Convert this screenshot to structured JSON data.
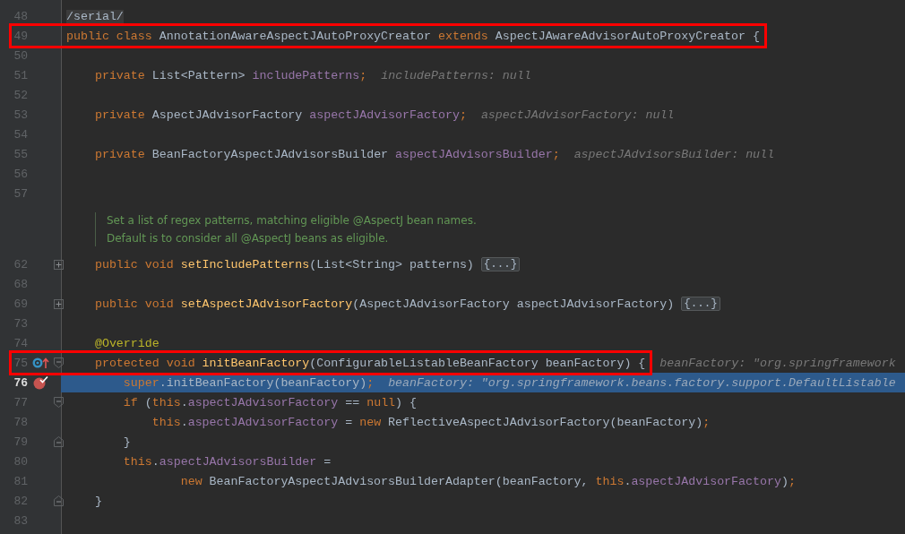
{
  "editor": {
    "rows": [
      {
        "kind": "code",
        "number": "48",
        "tokens": [
          {
            "text": "/serial/",
            "kind": "folded"
          }
        ]
      },
      {
        "kind": "code",
        "number": "49",
        "boxed": true,
        "tokens": [
          {
            "text": "public class ",
            "kind": "kw"
          },
          {
            "text": "AnnotationAwareAspectJAutoProxyCreator ",
            "kind": "plain"
          },
          {
            "text": "extends ",
            "kind": "kw"
          },
          {
            "text": "AspectJAwareAdvisorAutoProxyCreator {",
            "kind": "plain"
          }
        ]
      },
      {
        "kind": "code",
        "number": "50",
        "tokens": []
      },
      {
        "kind": "code",
        "number": "51",
        "tokens": [
          {
            "text": "    private ",
            "kind": "kw"
          },
          {
            "text": "List<Pattern> ",
            "kind": "plain"
          },
          {
            "text": "includePatterns",
            "kind": "field"
          },
          {
            "text": ";",
            "kind": "kw"
          }
        ],
        "hint": "includePatterns: null"
      },
      {
        "kind": "code",
        "number": "52",
        "tokens": []
      },
      {
        "kind": "code",
        "number": "53",
        "tokens": [
          {
            "text": "    private ",
            "kind": "kw"
          },
          {
            "text": "AspectJAdvisorFactory ",
            "kind": "plain"
          },
          {
            "text": "aspectJAdvisorFactory",
            "kind": "field"
          },
          {
            "text": ";",
            "kind": "kw"
          }
        ],
        "hint": "aspectJAdvisorFactory: null"
      },
      {
        "kind": "code",
        "number": "54",
        "tokens": []
      },
      {
        "kind": "code",
        "number": "55",
        "tokens": [
          {
            "text": "    private ",
            "kind": "kw"
          },
          {
            "text": "BeanFactoryAspectJAdvisorsBuilder ",
            "kind": "plain"
          },
          {
            "text": "aspectJAdvisorsBuilder",
            "kind": "field"
          },
          {
            "text": ";",
            "kind": "kw"
          }
        ],
        "hint": "aspectJAdvisorsBuilder: null"
      },
      {
        "kind": "code",
        "number": "56",
        "tokens": []
      },
      {
        "kind": "code",
        "number": "57",
        "tokens": []
      },
      {
        "kind": "doc",
        "lines": [
          "Set a list of regex patterns, matching eligible @AspectJ bean names.",
          "Default is to consider all @AspectJ beans as eligible."
        ]
      },
      {
        "kind": "code",
        "number": "62",
        "fold": {
          "kind": "expand"
        },
        "tokens": [
          {
            "text": "    public void ",
            "kind": "kw"
          },
          {
            "text": "setIncludePatterns",
            "kind": "method"
          },
          {
            "text": "(List<String> patterns) ",
            "kind": "plain"
          }
        ],
        "placeholder": "{...}"
      },
      {
        "kind": "code",
        "number": "68",
        "tokens": []
      },
      {
        "kind": "code",
        "number": "69",
        "fold": {
          "kind": "expand"
        },
        "tokens": [
          {
            "text": "    public void ",
            "kind": "kw"
          },
          {
            "text": "setAspectJAdvisorFactory",
            "kind": "method"
          },
          {
            "text": "(AspectJAdvisorFactory aspectJAdvisorFactory) ",
            "kind": "plain"
          }
        ],
        "placeholder": "{...}"
      },
      {
        "kind": "code",
        "number": "73",
        "tokens": []
      },
      {
        "kind": "code",
        "number": "74",
        "tokens": [
          {
            "text": "    @Override",
            "kind": "annot"
          }
        ]
      },
      {
        "kind": "code",
        "number": "75",
        "boxed": true,
        "marker": {
          "kind": "override"
        },
        "fold": {
          "kind": "start"
        },
        "tokens": [
          {
            "text": "    protected void ",
            "kind": "kw"
          },
          {
            "text": "initBeanFactory",
            "kind": "method"
          },
          {
            "text": "(ConfigurableListableBeanFactory beanFactory) {",
            "kind": "plain"
          }
        ],
        "hint": "beanFactory: \"org.springframework"
      },
      {
        "kind": "code",
        "number": "76",
        "current": true,
        "marker": {
          "kind": "breakpoint"
        },
        "tokens": [
          {
            "text": "        super",
            "kind": "kw"
          },
          {
            "text": ".initBeanFactory(beanFactory)",
            "kind": "plain"
          },
          {
            "text": ";",
            "kind": "kw"
          }
        ],
        "hint": "beanFactory: \"org.springframework.beans.factory.support.DefaultListable"
      },
      {
        "kind": "code",
        "number": "77",
        "fold": {
          "kind": "start"
        },
        "tokens": [
          {
            "text": "        if ",
            "kind": "kw"
          },
          {
            "text": "(",
            "kind": "plain"
          },
          {
            "text": "this",
            "kind": "kw"
          },
          {
            "text": ".",
            "kind": "plain"
          },
          {
            "text": "aspectJAdvisorFactory",
            "kind": "field"
          },
          {
            "text": " == ",
            "kind": "plain"
          },
          {
            "text": "null",
            "kind": "kw"
          },
          {
            "text": ") {",
            "kind": "plain"
          }
        ]
      },
      {
        "kind": "code",
        "number": "78",
        "tokens": [
          {
            "text": "            this",
            "kind": "kw"
          },
          {
            "text": ".",
            "kind": "plain"
          },
          {
            "text": "aspectJAdvisorFactory",
            "kind": "field"
          },
          {
            "text": " = ",
            "kind": "plain"
          },
          {
            "text": "new ",
            "kind": "kw"
          },
          {
            "text": "ReflectiveAspectJAdvisorFactory(beanFactory)",
            "kind": "plain"
          },
          {
            "text": ";",
            "kind": "kw"
          }
        ]
      },
      {
        "kind": "code",
        "number": "79",
        "fold": {
          "kind": "end"
        },
        "tokens": [
          {
            "text": "        }",
            "kind": "plain"
          }
        ]
      },
      {
        "kind": "code",
        "number": "80",
        "tokens": [
          {
            "text": "        this",
            "kind": "kw"
          },
          {
            "text": ".",
            "kind": "plain"
          },
          {
            "text": "aspectJAdvisorsBuilder",
            "kind": "field"
          },
          {
            "text": " =",
            "kind": "plain"
          }
        ]
      },
      {
        "kind": "code",
        "number": "81",
        "tokens": [
          {
            "text": "                new ",
            "kind": "kw"
          },
          {
            "text": "BeanFactoryAspectJAdvisorsBuilderAdapter(beanFactory, ",
            "kind": "plain"
          },
          {
            "text": "this",
            "kind": "kw"
          },
          {
            "text": ".",
            "kind": "plain"
          },
          {
            "text": "aspectJAdvisorFactory",
            "kind": "field"
          },
          {
            "text": ")",
            "kind": "plain"
          },
          {
            "text": ";",
            "kind": "kw"
          }
        ]
      },
      {
        "kind": "code",
        "number": "82",
        "fold": {
          "kind": "end"
        },
        "tokens": [
          {
            "text": "    }",
            "kind": "plain"
          }
        ]
      },
      {
        "kind": "code",
        "number": "83",
        "tokens": []
      }
    ]
  }
}
